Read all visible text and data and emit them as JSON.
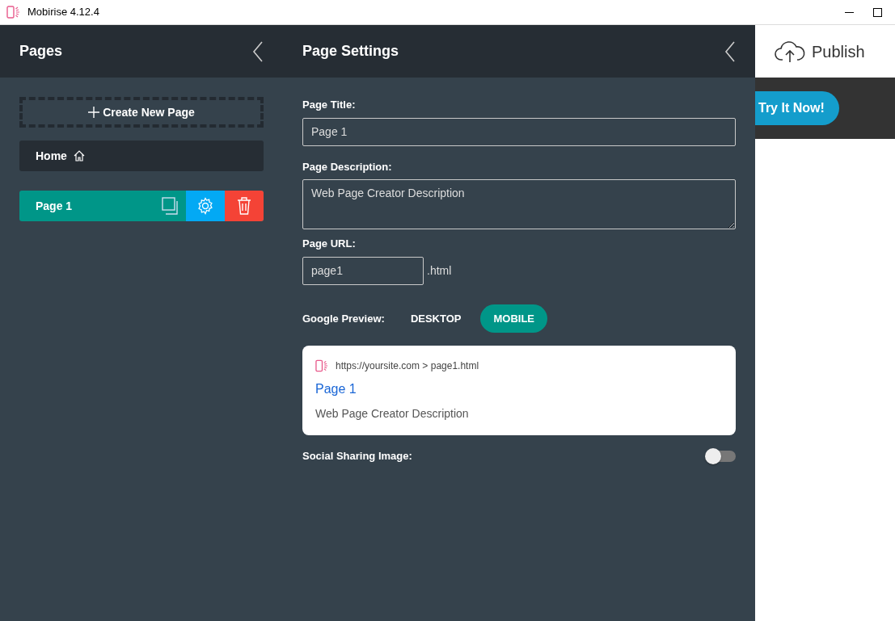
{
  "window": {
    "title": "Mobirise 4.12.4"
  },
  "pages_panel": {
    "title": "Pages",
    "create_label": "Create New Page",
    "pages": [
      {
        "label": "Home",
        "kind": "home",
        "selected": false
      },
      {
        "label": "Page 1",
        "kind": "page",
        "selected": true
      }
    ]
  },
  "page_settings": {
    "title": "Page Settings",
    "page_title": {
      "label": "Page Title:",
      "value": "Page 1"
    },
    "page_description": {
      "label": "Page Description:",
      "value": "Web Page Creator Description"
    },
    "page_url": {
      "label": "Page URL:",
      "value": "page1",
      "suffix": ".html"
    },
    "google_preview": {
      "label": "Google Preview:",
      "modes": [
        {
          "label": "DESKTOP",
          "selected": false
        },
        {
          "label": "MOBILE",
          "selected": true
        }
      ],
      "result": {
        "url": "https://yoursite.com > page1.html",
        "title": "Page 1",
        "description": "Web Page Creator Description"
      }
    },
    "social_sharing": {
      "label": "Social Sharing Image:",
      "on": false
    }
  },
  "site_preview": {
    "publish_label": "Publish",
    "cta_label": "Try It Now!"
  }
}
